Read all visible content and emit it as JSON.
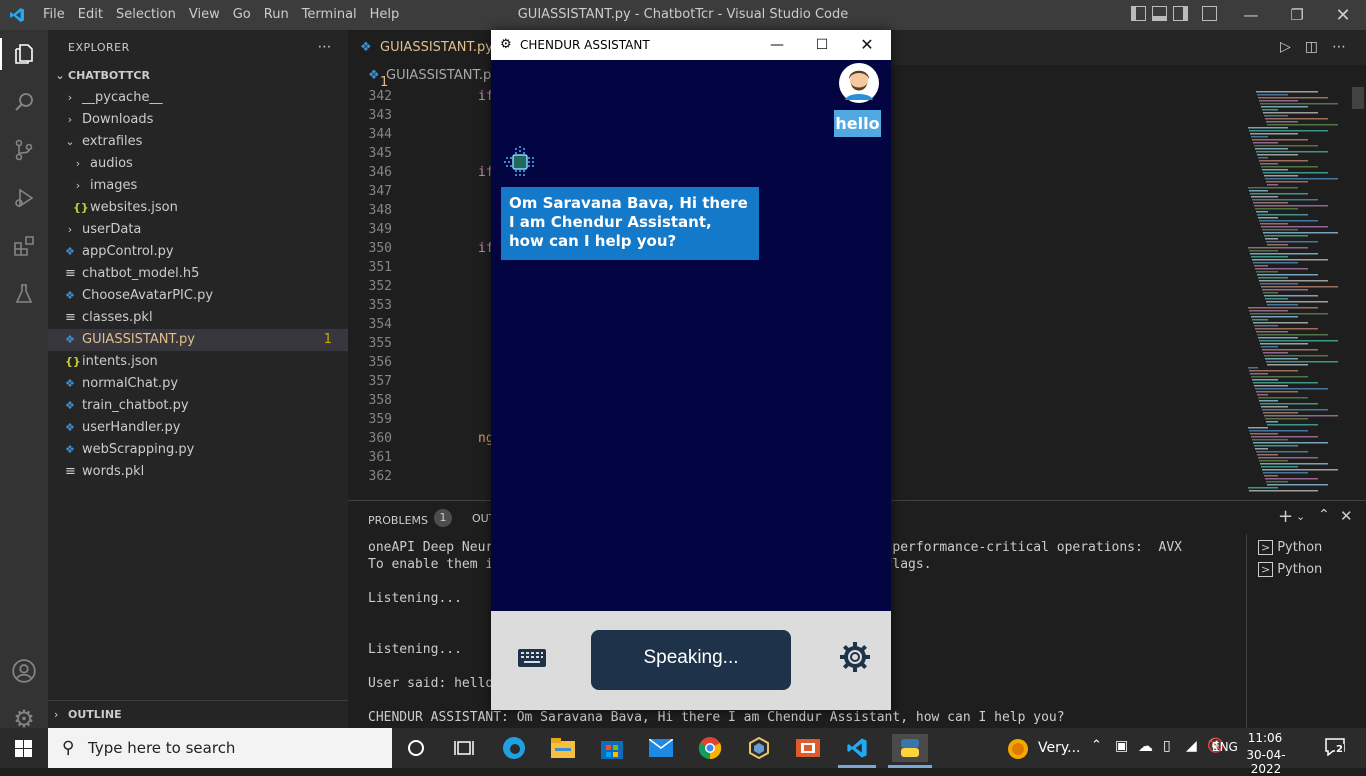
{
  "window": {
    "title": "GUIASSISTANT.py - ChatbotTcr - Visual Studio Code",
    "menus": [
      "File",
      "Edit",
      "Selection",
      "View",
      "Go",
      "Run",
      "Terminal",
      "Help"
    ]
  },
  "explorer": {
    "header": "EXPLORER",
    "project": "CHATBOTTCR",
    "outline": "OUTLINE",
    "items": [
      {
        "label": "__pycache__",
        "type": "folder",
        "depth": 1,
        "expanded": false
      },
      {
        "label": "Downloads",
        "type": "folder",
        "depth": 1,
        "expanded": false
      },
      {
        "label": "extrafiles",
        "type": "folder",
        "depth": 1,
        "expanded": true
      },
      {
        "label": "audios",
        "type": "folder",
        "depth": 2,
        "expanded": false
      },
      {
        "label": "images",
        "type": "folder",
        "depth": 2,
        "expanded": false
      },
      {
        "label": "websites.json",
        "type": "json",
        "depth": 2
      },
      {
        "label": "userData",
        "type": "folder",
        "depth": 1,
        "expanded": false
      },
      {
        "label": "appControl.py",
        "type": "py",
        "depth": 1
      },
      {
        "label": "chatbot_model.h5",
        "type": "file",
        "depth": 1
      },
      {
        "label": "ChooseAvatarPIC.py",
        "type": "py",
        "depth": 1
      },
      {
        "label": "classes.pkl",
        "type": "file",
        "depth": 1
      },
      {
        "label": "GUIASSISTANT.py",
        "type": "py",
        "depth": 1,
        "selected": true,
        "badge": "1"
      },
      {
        "label": "intents.json",
        "type": "json",
        "depth": 1
      },
      {
        "label": "normalChat.py",
        "type": "py",
        "depth": 1
      },
      {
        "label": "train_chatbot.py",
        "type": "py",
        "depth": 1
      },
      {
        "label": "userHandler.py",
        "type": "py",
        "depth": 1
      },
      {
        "label": "webScrapping.py",
        "type": "py",
        "depth": 1
      },
      {
        "label": "words.pkl",
        "type": "file",
        "depth": 1
      }
    ]
  },
  "editor": {
    "tab": "GUIASSISTANT.py 1",
    "breadcrumb": "GUIASSISTANT.py",
    "line_numbers": [
      "342",
      "343",
      "344",
      "345",
      "346",
      "347",
      "348",
      "349",
      "350",
      "351",
      "352",
      "353",
      "354",
      "355",
      "356",
      "357",
      "358",
      "359",
      "360",
      "361",
      "362"
    ],
    "lines": [
      "if",
      "",
      "",
      "",
      "if",
      "",
      "",
      "",
      "if",
      "",
      "",
      "",
      "",
      "",
      "",
      "",
      "d)",
      "",
      "nged my voice. How may I help you?\", True, Tru",
      "",
      ""
    ]
  },
  "panel": {
    "problems_label": "PROBLEMS",
    "problems_count": "1",
    "output_label": "OUT",
    "terminal_lines": [
      "oneAPI Deep Neural                                      uctions in performance-critical operations:  AVX",
      "To enable them in                                      e compiler flags.",
      "",
      "Listening...",
      "",
      "",
      "Listening...",
      "",
      "User said: hello",
      "",
      "CHENDUR ASSISTANT: Om Saravana Bava, Hi there I am Chendur Assistant, how can I help you?"
    ],
    "terminals": [
      "Python",
      "Python"
    ]
  },
  "chat": {
    "title": "CHENDUR ASSISTANT",
    "user_message": "hello",
    "bot_message": "Om Saravana Bava, Hi there I am Chendur Assistant, how can I help you?",
    "speak_button": "Speaking..."
  },
  "taskbar": {
    "search_placeholder": "Type here to search",
    "weather": "Very...",
    "lang": "ENG",
    "time": "11:06",
    "date": "30-04-2022",
    "notifications": "2"
  }
}
